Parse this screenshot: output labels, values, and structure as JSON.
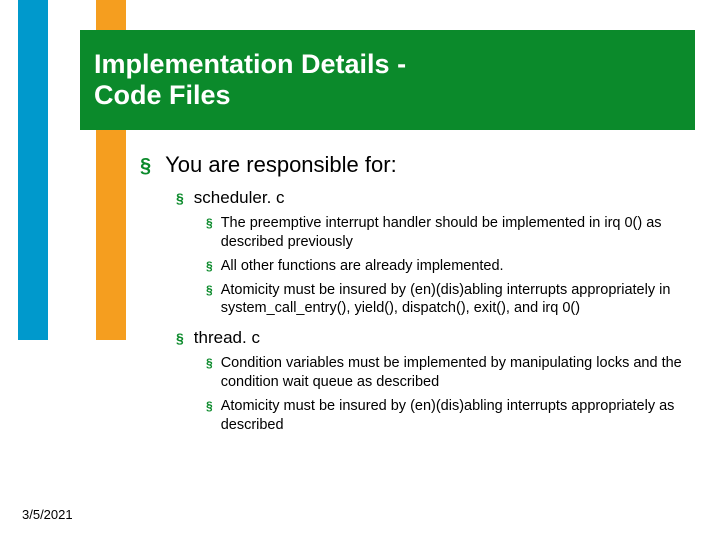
{
  "title_line1": "Implementation Details -",
  "title_line2": "Code Files",
  "bullets": {
    "l1": "You are responsible for:",
    "scheduler": {
      "label": "scheduler. c",
      "items": [
        "The preemptive interrupt handler should be implemented in irq 0() as described previously",
        "All other functions are already implemented.",
        "Atomicity must be insured by (en)(dis)abling interrupts appropriately in system_call_entry(), yield(), dispatch(), exit(), and irq 0()"
      ]
    },
    "thread": {
      "label": "thread. c",
      "items": [
        "Condition variables must be implemented by manipulating locks and the condition wait queue as described",
        "Atomicity must be insured by (en)(dis)abling interrupts appropriately as described"
      ]
    }
  },
  "footer_date": "3/5/2021",
  "marker": "§"
}
